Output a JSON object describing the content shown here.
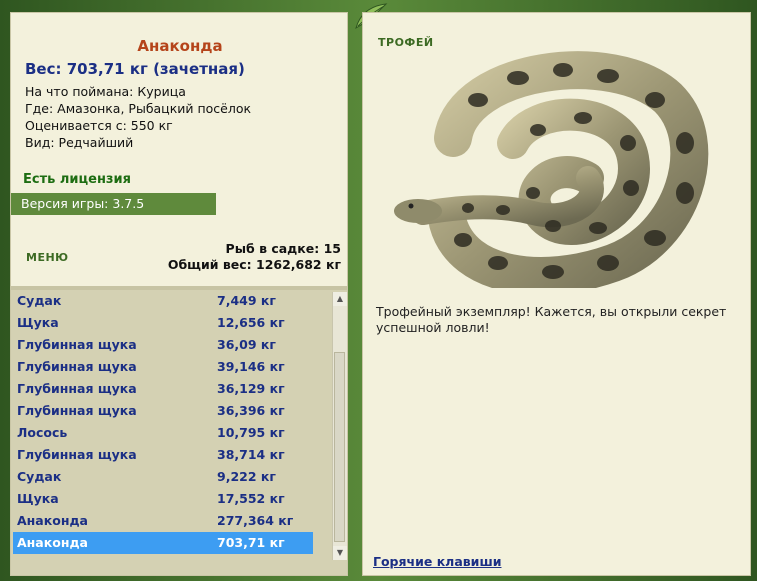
{
  "catch": {
    "title": "Анаконда",
    "weight": "Вес: 703,71 кг (зачетная)",
    "bait": "На что поймана: Курица",
    "location": "Где: Амазонка, Рыбацкий посёлок",
    "value": "Оценивается с: 550 кг",
    "rarity": "Вид: Редчайший"
  },
  "license": "Есть лицензия",
  "version": "Версия игры: 3.7.5",
  "menu_label": "МЕНЮ",
  "stats": {
    "fish_count": "Рыб в садке: 15",
    "total_weight": "Общий вес: 1262,682 кг"
  },
  "fish_list": [
    {
      "name": "Судак",
      "weight": "7,449 кг"
    },
    {
      "name": "Щука",
      "weight": "12,656 кг"
    },
    {
      "name": "Глубинная щука",
      "weight": "36,09 кг"
    },
    {
      "name": "Глубинная щука",
      "weight": "39,146 кг"
    },
    {
      "name": "Глубинная щука",
      "weight": "36,129 кг"
    },
    {
      "name": "Глубинная щука",
      "weight": "36,396 кг"
    },
    {
      "name": "Лосось",
      "weight": "10,795 кг"
    },
    {
      "name": "Глубинная щука",
      "weight": "38,714 кг"
    },
    {
      "name": "Судак",
      "weight": "9,222 кг"
    },
    {
      "name": "Щука",
      "weight": "17,552 кг"
    },
    {
      "name": "Анаконда",
      "weight": "277,364 кг"
    },
    {
      "name": "Анаконда",
      "weight": "703,71 кг",
      "selected": true
    }
  ],
  "trophy": {
    "label": "ТРОФЕЙ",
    "text": "Трофейный экземпляр! Кажется, вы открыли секрет успешной ловли!",
    "image_icon": "anaconda-image"
  },
  "hotkeys_link": "Горячие клавиши",
  "colors": {
    "frame": "#3f6b2a",
    "panel": "#f3f1dc",
    "accent_title": "#b5441a",
    "blue_text": "#1b2f85",
    "green_text": "#1d6d12",
    "selection": "#3d9df2"
  }
}
